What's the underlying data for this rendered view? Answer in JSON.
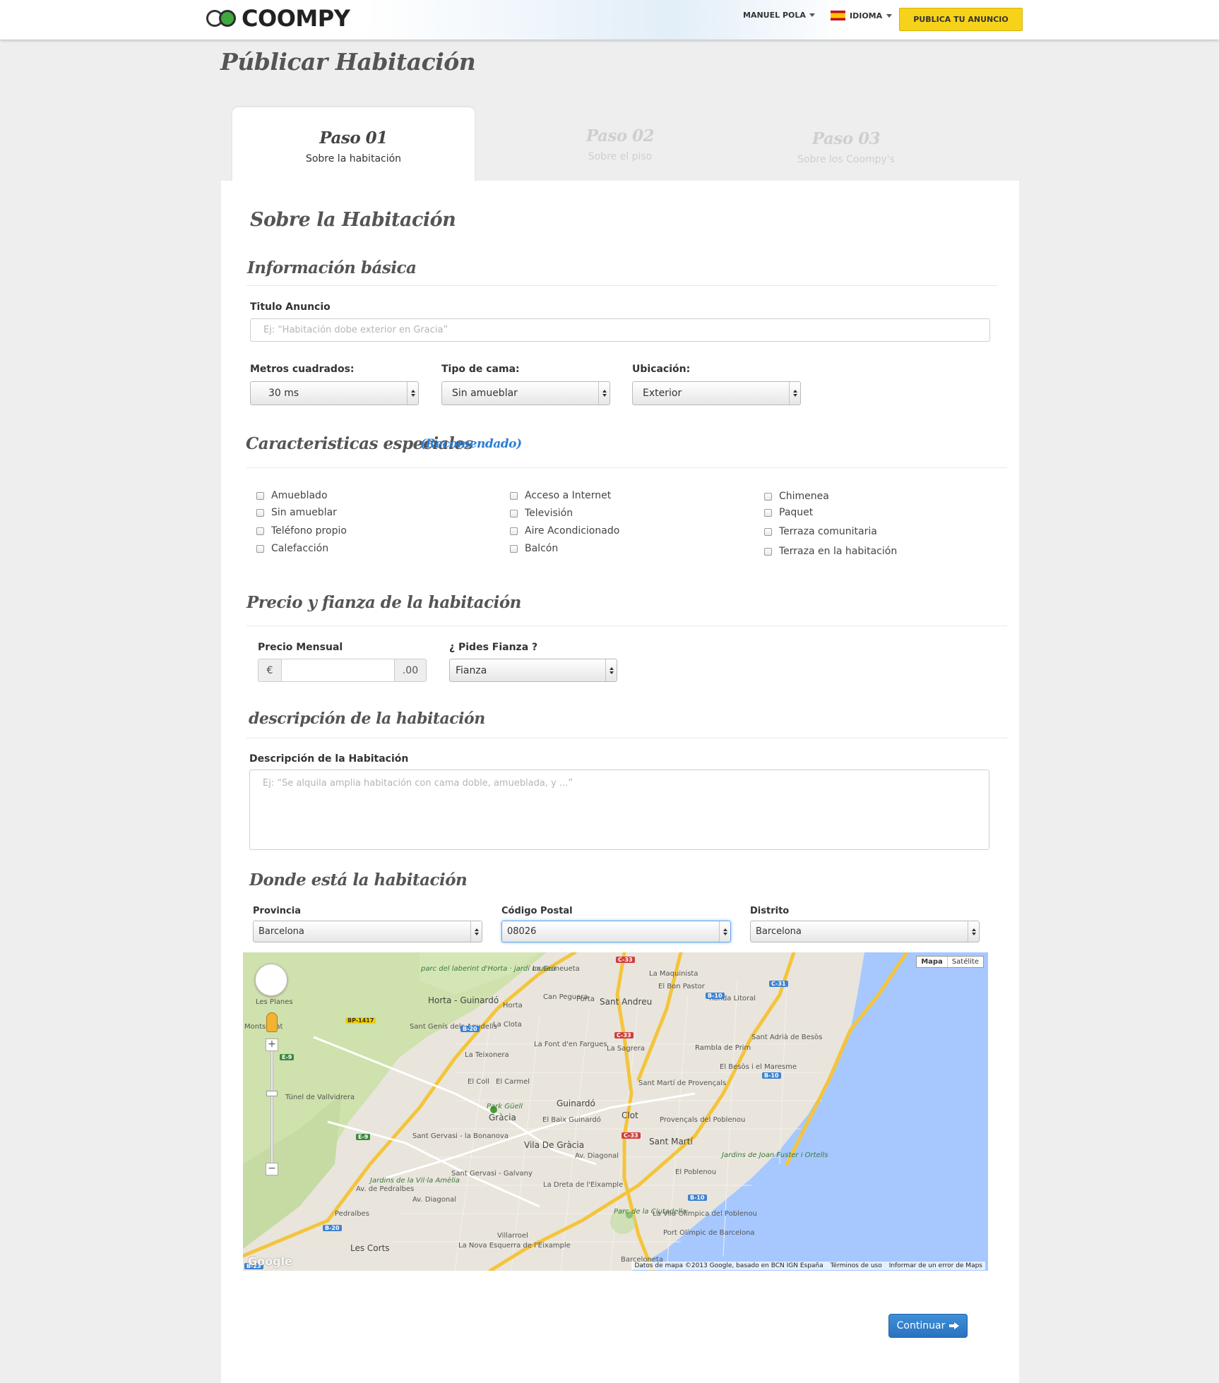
{
  "header": {
    "logo": "COOMPY",
    "user": "MANUEL POLA",
    "language": "IDIOMA",
    "publish": "PUBLICA TU ANUNCIO"
  },
  "page_title": "Públicar Habitación",
  "steps": [
    {
      "num": "Paso 01",
      "label": "Sobre la habitación"
    },
    {
      "num": "Paso 02",
      "label": "Sobre el piso"
    },
    {
      "num": "Paso 03",
      "label": "Sobre los Coompy's"
    }
  ],
  "form": {
    "title": "Sobre la Habitación",
    "basic": {
      "title": "Información básica",
      "ad_title_label": "Titulo Anuncio",
      "ad_title_placeholder": "Ej: “Habitación dobe exterior en Gracia”",
      "meters_label": "Metros cuadrados:",
      "meters_value": "30 ms",
      "bed_label": "Tipo de cama:",
      "bed_value": "Sin amueblar",
      "location_label": "Ubicación:",
      "location_value": "Exterior"
    },
    "features": {
      "title": "Caracteristicas especiales",
      "recommended": "(Recomendado)",
      "items": [
        "Amueblado",
        "Sin amueblar",
        "Teléfono propio",
        "Calefacción",
        "Acceso a Internet",
        "Televisión",
        "Aire Acondicionado",
        "Balcón",
        "Chimenea",
        "Paquet",
        "Terraza comunitaria",
        "Terraza en la habitación"
      ]
    },
    "price": {
      "title": "Precio y fianza de la habitación",
      "monthly_label": "Precio Mensual",
      "currency": "€",
      "cents": ".00",
      "deposit_label": "¿ Pides Fianza ?",
      "deposit_value": "Fianza"
    },
    "description": {
      "title": "descripción de la habitación",
      "label": "Descripción de la Habitación",
      "placeholder": "Ej: “Se alquila amplia habitación con cama doble, amueblada, y ...”"
    },
    "where": {
      "title": "Donde está la habitación",
      "province_label": "Provincia",
      "province_value": "Barcelona",
      "postal_label": "Código Postal",
      "postal_value": "08026",
      "district_label": "Distrito",
      "district_value": "Barcelona"
    }
  },
  "map": {
    "btn_map": "Mapa",
    "btn_sat": "Satélite",
    "footer_data": "Datos de mapa ©2013 Google, basado en BCN IGN España",
    "footer_terms": "Términos de uso",
    "footer_report": "Informar de un error de Maps",
    "google": "Google",
    "labels": [
      "parc del laberint d'Horta · jardí museu",
      "Horta - Guinardó",
      "Horta",
      "Les Planes",
      "Sant Genís dels Agudells",
      "La Clota",
      "La Teixonera",
      "El Coll",
      "El Carmel",
      "Park Güell",
      "Gràcia",
      "Guinardó",
      "El Baix Guinardó",
      "Vila De Gràcia",
      "Sant Gervasi - la Bonanova",
      "Sant Gervasi - Galvany",
      "Jardins de la Vil·la Amèlia",
      "Pedralbes",
      "Les Corts",
      "Villarroel",
      "La Nova Esquerra de l'Eixample",
      "La Dreta de l'Eixample",
      "Parc de la Ciutadella",
      "Barceloneta",
      "La Guineueta",
      "Porta",
      "Can Peguera",
      "Sant Andreu",
      "La Maquinista",
      "El Bon Pastor",
      "La Font d'en Fargues",
      "La Sagrera",
      "Clot",
      "Sant Martí de Provençals",
      "Provençals del Poblenou",
      "Sant Martí",
      "El Poblenou",
      "La Vila Olímpica del Poblenou",
      "Port Olímpic de Barcelona",
      "Jardins de Joan Fuster i Ortells",
      "Sant Adrià de Besòs",
      "El Besòs i el Maresme",
      "Ronda Litoral",
      "Rambla de Prim",
      "Av. Diagonal",
      "Av. de Pedralbes",
      "Túnel de Vallvidrera",
      "Montserrat",
      "Av. Diagonal"
    ],
    "roads": [
      "C-33",
      "C-33",
      "C-31",
      "B-10",
      "B-10",
      "B-10",
      "B-20",
      "B-20",
      "BP-1417",
      "E-9",
      "E-9",
      "C-33",
      "B-23"
    ]
  },
  "continue": "Continuar"
}
